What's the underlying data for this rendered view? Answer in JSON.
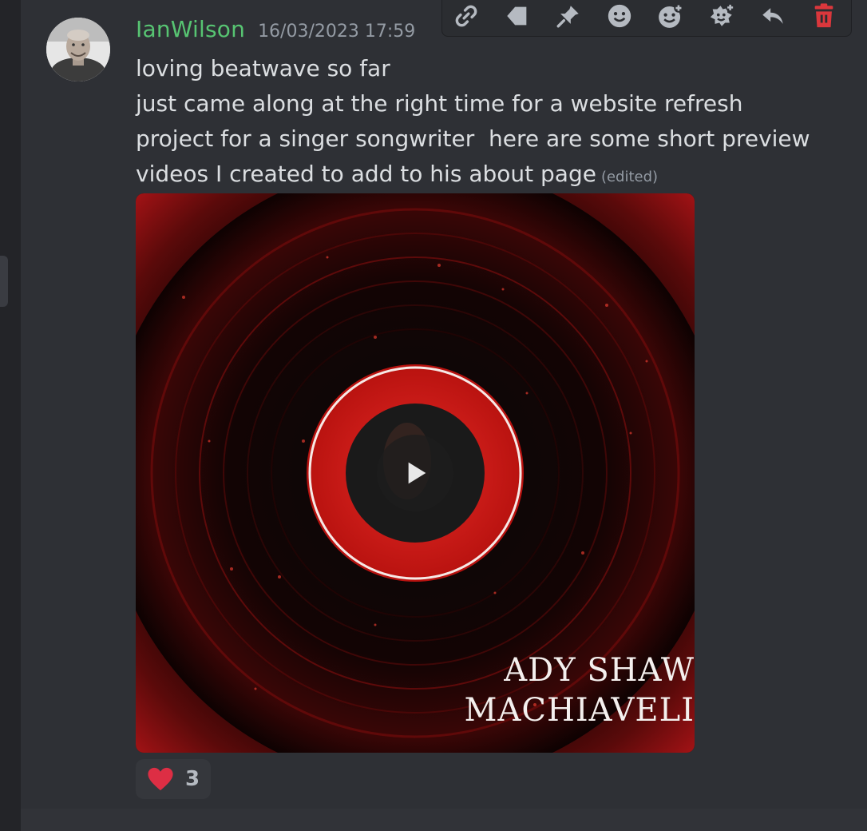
{
  "message": {
    "author": "IanWilson",
    "timestamp": "16/03/2023 17:59",
    "lines": [
      "loving beatwave so far",
      "just came along at the right time for a website refresh",
      "project for a singer songwriter  here are some short preview",
      "videos I created to add to his about page"
    ],
    "edited_label": "(edited)"
  },
  "video": {
    "overlay_line_1": "ADY SHAW",
    "overlay_line_2": "MACHIAVELI"
  },
  "reaction": {
    "emoji": "heart-icon",
    "count": "3"
  },
  "toolbar": {
    "icons": [
      "link-icon",
      "mark-unread-icon",
      "pin-icon",
      "add-reaction-icon",
      "super-reaction-icon",
      "add-reaction-plus-icon",
      "reply-icon",
      "delete-icon"
    ],
    "delete_color": "#da373c"
  },
  "colors": {
    "username": "#57c472",
    "background": "#2b2d31",
    "text": "#dbdee1",
    "muted": "#949ba4",
    "vinyl_red": "#c0161a"
  }
}
